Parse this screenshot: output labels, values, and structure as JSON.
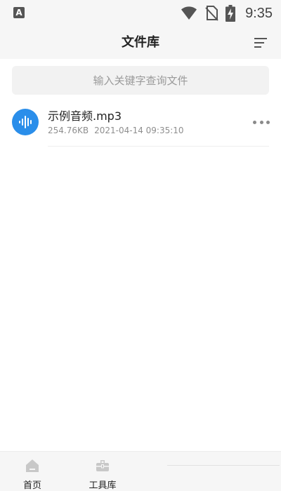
{
  "status_bar": {
    "app_icon_letter": "A",
    "time": "9:35",
    "icons": [
      "wifi-icon",
      "no-sim-icon",
      "battery-charging-icon"
    ]
  },
  "header": {
    "title": "文件库",
    "sort_icon": "sort-lines-icon"
  },
  "search": {
    "placeholder": "输入关键字查询文件",
    "value": ""
  },
  "files": [
    {
      "name": "示例音频.mp3",
      "size": "254.76KB",
      "date": "2021-04-14 09:35:10",
      "icon": "audio-wave-icon",
      "more_icon": "more-dots-icon"
    }
  ],
  "bottom_nav": {
    "items": [
      {
        "label": "首页",
        "icon": "home-icon"
      },
      {
        "label": "工具库",
        "icon": "toolbox-icon"
      }
    ]
  },
  "colors": {
    "accent": "#2a8eea",
    "background": "#f6f6f6",
    "text": "#222222",
    "secondary_text": "#8e8e8e"
  }
}
